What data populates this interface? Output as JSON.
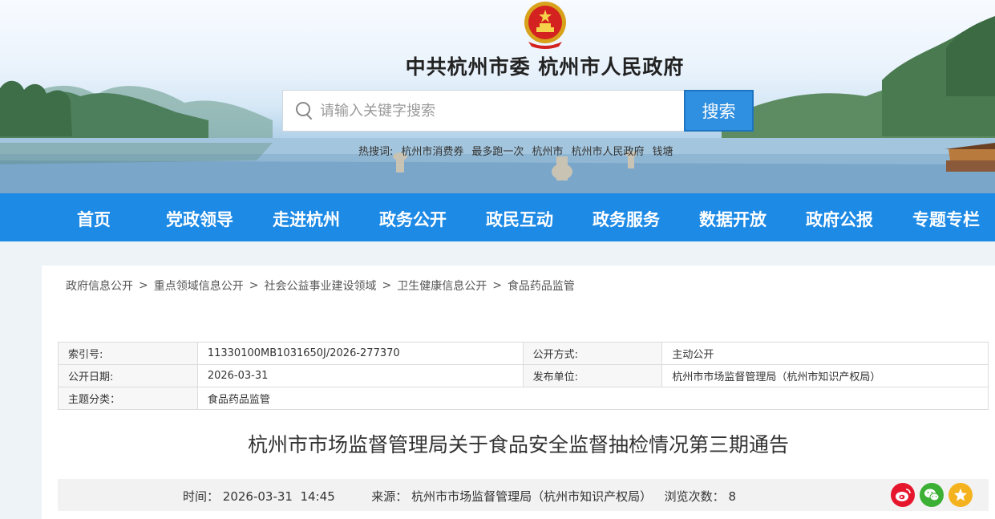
{
  "header": {
    "site_title": "中共杭州市委 杭州市人民政府",
    "search": {
      "placeholder": "请输入关键字搜索",
      "button_label": "搜索"
    },
    "hotwords": [
      "热搜词:",
      "杭州市消费券",
      "最多跑一次",
      "杭州市",
      "杭州市人民政府",
      "钱塘"
    ]
  },
  "nav": {
    "items": [
      "首页",
      "党政领导",
      "走进杭州",
      "政务公开",
      "政民互动",
      "政务服务",
      "数据开放",
      "政府公报",
      "专题专栏"
    ]
  },
  "breadcrumb": [
    "政府信息公开",
    "重点领域信息公开",
    "社会公益事业建设领域",
    "卫生健康信息公开",
    "食品药品监管"
  ],
  "breadcrumb_separator": ">",
  "meta": {
    "index_label": "索引号:",
    "index_value": "11330100MB1031650J/2026-277370",
    "open_method_label": "公开方式:",
    "open_method_value": "主动公开",
    "date_label": "公开日期:",
    "date_value": "2026-03-31",
    "publisher_label": "发布单位:",
    "publisher_value": "杭州市市场监督管理局（杭州市知识产权局）",
    "topic_label": "主题分类：",
    "topic_value": "食品药品监管"
  },
  "article": {
    "title": "杭州市市场监督管理局关于食品安全监督抽检情况第三期通告",
    "time_label": "时间：",
    "time_value": "2026-03-31  14:45",
    "source_label": "来源：",
    "source_value": "杭州市市场监督管理局（杭州市知识产权局）",
    "views_label": "浏览次数：",
    "views_value": "8"
  },
  "share": {
    "icons": [
      "weibo-icon",
      "wechat-icon",
      "favorite-icon"
    ]
  },
  "colors": {
    "nav_bg": "#1d8ae6",
    "search_btn": "#2f8fe0",
    "weibo": "#e6162d",
    "wechat": "#3cb034",
    "favorite": "#f5b21f"
  }
}
